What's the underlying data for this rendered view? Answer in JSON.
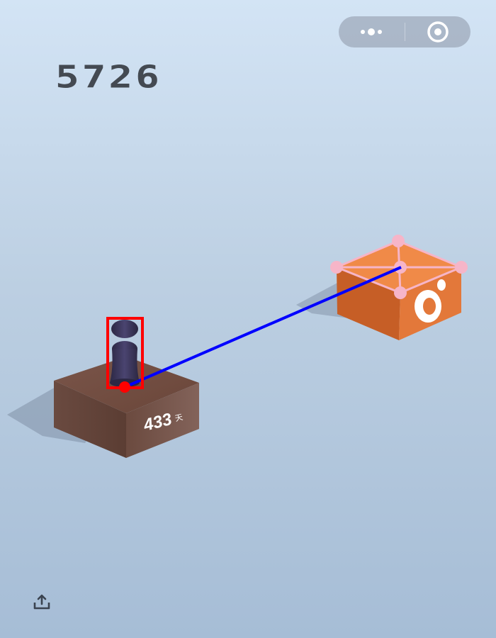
{
  "hud": {
    "score": "5726",
    "menu_icon": "more-dots-icon",
    "close_icon": "target-circle-icon",
    "share_icon": "share-upload-icon"
  },
  "scene": {
    "current_block": {
      "label": "433",
      "label_suffix": "天",
      "material": "wood"
    },
    "target_block": {
      "color": "#e8763a",
      "decal": "orange-ring-icon"
    }
  },
  "colors": {
    "bbox_player": "#ff0000",
    "aim_line": "#0000ff",
    "target_marks": "#f6b5c8",
    "player": "#3b3658"
  }
}
